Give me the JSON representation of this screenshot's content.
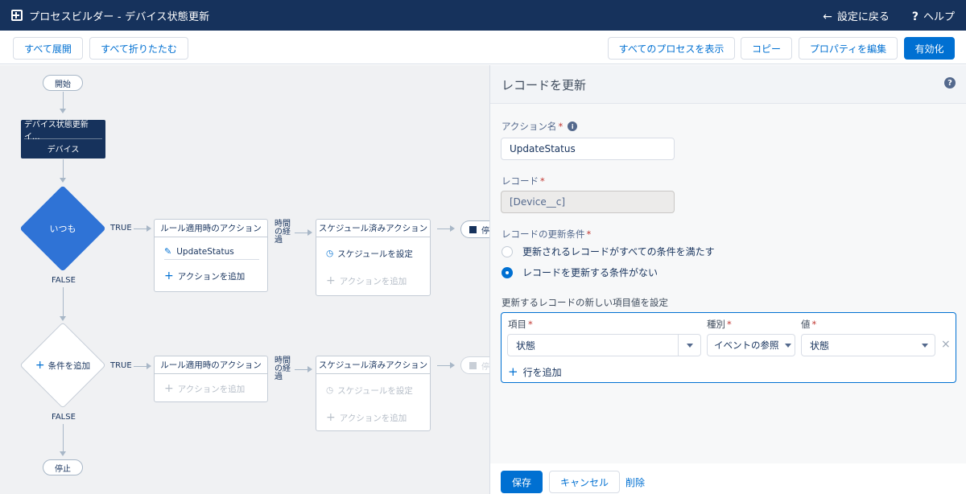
{
  "app": {
    "title": "プロセスビルダー - デバイス状態更新",
    "back_label": "設定に戻る",
    "help_label": "ヘルプ",
    "back_glyph": "←",
    "help_glyph": "?"
  },
  "toolbar": {
    "expand_all": "すべて展開",
    "collapse_all": "すべて折りたたむ",
    "view_all": "すべてのプロセスを表示",
    "copy": "コピー",
    "edit_props": "プロパティを編集",
    "activate": "有効化"
  },
  "canvas": {
    "start": "開始",
    "object_name": "デバイス状態更新イ...",
    "object_type": "デバイス",
    "criteria1": "いつも",
    "true_label": "TRUE",
    "false_label": "FALSE",
    "immediate_header": "ルール適用時のアクション",
    "action_name": "UpdateStatus",
    "add_action": "アクションを追加",
    "time_label_1": "時間",
    "time_label_2": "の経",
    "time_label_3": "過",
    "scheduled_header": "スケジュール済みアクション",
    "set_schedule": "スケジュールを設定",
    "end_label": "停",
    "add_criteria": "条件を追加",
    "stop": "停止",
    "plus_glyph": "+"
  },
  "panel": {
    "title": "レコードを更新",
    "action_name_label": "アクション名",
    "action_name_value": "UpdateStatus",
    "record_label": "レコード",
    "record_value": "[Device__c]",
    "criteria_label": "レコードの更新条件",
    "radio_option_1": "更新されるレコードがすべての条件を満たす",
    "radio_option_2": "レコードを更新する条件がない",
    "set_fields_label": "更新するレコードの新しい項目値を設定",
    "col_field": "項目",
    "col_type": "種別",
    "col_value": "値",
    "row_field": "状態",
    "row_type": "イベントの参照",
    "row_value": "状態",
    "add_row": "行を追加",
    "save": "保存",
    "cancel": "キャンセル",
    "delete": "削除"
  },
  "colors": {
    "header_bg": "#16325c",
    "brand": "#0070d2",
    "criteria_active": "#2f73d6"
  }
}
